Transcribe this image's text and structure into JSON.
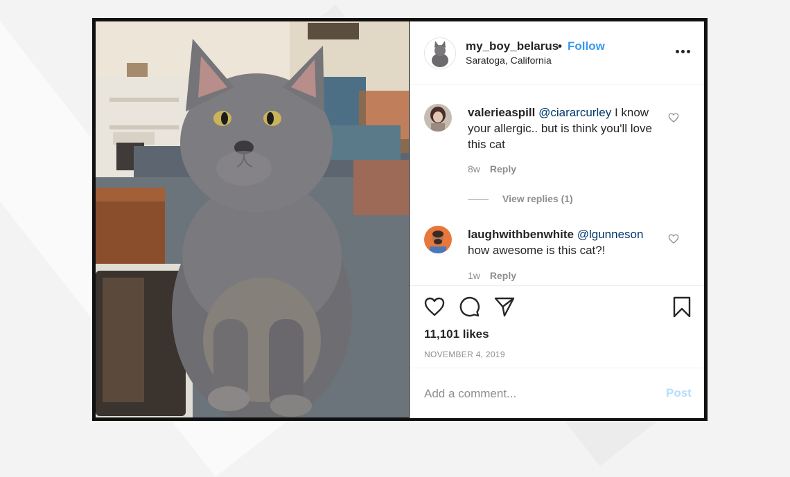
{
  "header": {
    "username": "my_boy_belarus",
    "separator": "•",
    "follow_label": "Follow",
    "location": "Saratoga, California"
  },
  "comments": [
    {
      "username": "valerieaspill",
      "mention": "@ciararcurley",
      "text": "I know your allergic.. but is think you'll love this cat",
      "age": "8w",
      "reply_label": "Reply",
      "view_replies": "View replies (1)"
    },
    {
      "username": "laughwithbenwhite",
      "mention": "@lgunneson",
      "text": "how awesome is this cat?!",
      "age": "1w",
      "reply_label": "Reply"
    }
  ],
  "actions": {
    "icons": [
      "heart-icon",
      "comment-icon",
      "share-icon",
      "bookmark-icon"
    ],
    "likes": "11,101 likes",
    "date": "NOVEMBER 4, 2019"
  },
  "add_comment": {
    "placeholder": "Add a comment...",
    "post_label": "Post"
  },
  "colors": {
    "accent": "#3897f0",
    "post_disabled": "#b2dffc",
    "text": "#262626",
    "muted": "#8e8e8e"
  }
}
